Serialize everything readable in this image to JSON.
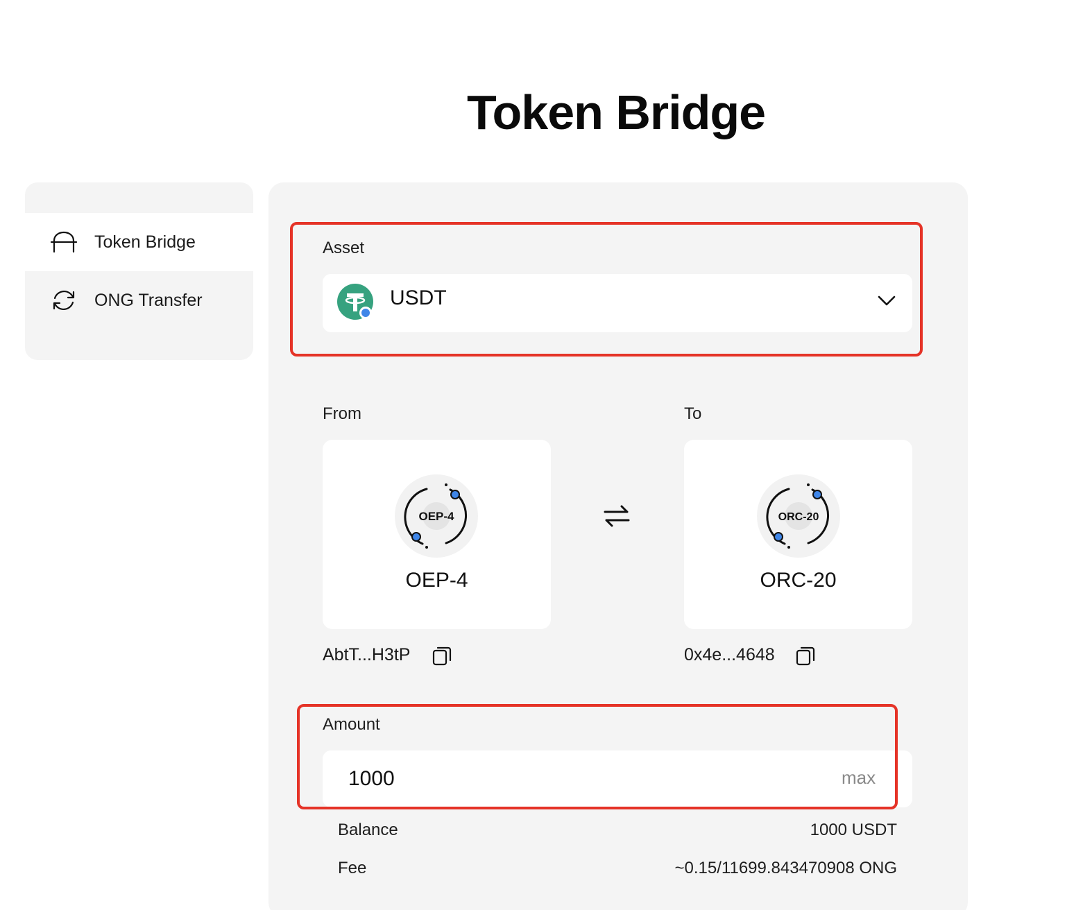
{
  "page": {
    "title": "Token Bridge"
  },
  "sidebar": {
    "items": [
      {
        "label": "Token Bridge",
        "icon": "bridge-icon",
        "active": true
      },
      {
        "label": "ONG Transfer",
        "icon": "refresh-icon",
        "active": false
      }
    ]
  },
  "asset": {
    "label": "Asset",
    "selected": "USDT",
    "icon": "usdt-logo-icon",
    "dropdown_icon": "chevron-down-icon"
  },
  "bridge": {
    "from": {
      "label": "From",
      "network": "OEP-4",
      "logo_text": "OEP-4",
      "address": "AbtT...H3tP"
    },
    "to": {
      "label": "To",
      "network": "ORC-20",
      "logo_text": "ORC-20",
      "address": "0x4e...4648"
    },
    "swap_icon": "swap-arrows-icon"
  },
  "amount": {
    "label": "Amount",
    "value": "1000",
    "max_label": "max"
  },
  "info": {
    "balance_label": "Balance",
    "balance_value": "1000 USDT",
    "fee_label": "Fee",
    "fee_value": "~0.15/11699.843470908 ONG"
  },
  "colors": {
    "highlight": "#e53327",
    "usdt_green": "#36a27f",
    "node_blue": "#3f86e8",
    "panel_bg": "#f4f4f4"
  }
}
